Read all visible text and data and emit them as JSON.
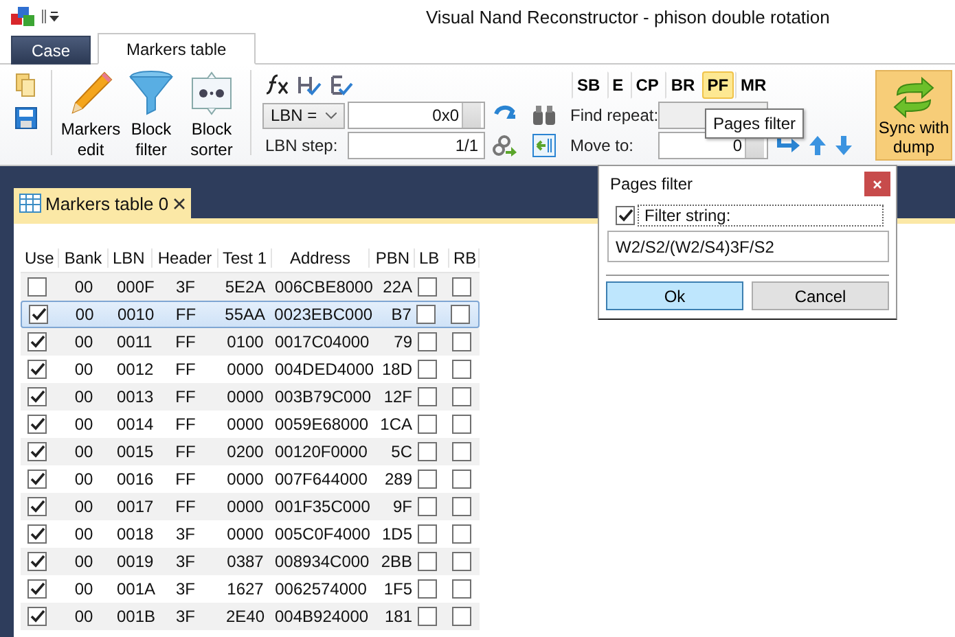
{
  "window": {
    "title": "Visual Nand Reconstructor - phison double rotation"
  },
  "ribbon_tabs": [
    {
      "label": "Case",
      "selected": false
    },
    {
      "label": "Markers table",
      "selected": true
    }
  ],
  "ribbon": {
    "large_buttons": [
      {
        "label": "Markers edit",
        "kind": "pencil"
      },
      {
        "label": "Block filter",
        "kind": "funnel"
      },
      {
        "label": "Block sorter",
        "kind": "sorter"
      }
    ],
    "lbn_mode": "LBN =",
    "lbn_value": "0x0",
    "lbn_step_label": "LBN step:",
    "lbn_step_value": "1/1",
    "mode_buttons": [
      {
        "label": "SB",
        "selected": false
      },
      {
        "label": "E",
        "selected": false
      },
      {
        "label": "CP",
        "selected": false
      },
      {
        "label": "BR",
        "selected": false
      },
      {
        "label": "PF",
        "selected": true
      },
      {
        "label": "MR",
        "selected": false
      }
    ],
    "find_repeat_label": "Find repeat:",
    "move_to_label": "Move to:",
    "move_to_value": "0",
    "sync_button": "Sync with dump"
  },
  "tooltip": "Pages filter",
  "document_tab": {
    "label": "Markers table 0"
  },
  "table": {
    "columns": [
      "Use",
      "Bank",
      "LBN",
      "Header",
      "Test 1",
      "Address",
      "PBN",
      "LB",
      "RB"
    ],
    "rows": [
      {
        "use": false,
        "selected": false,
        "bank": "00",
        "lbn": "000F",
        "header": "3F",
        "test_1": "5E2A",
        "address": "006CBE8000",
        "pbn": "22A",
        "lb": false,
        "rb": false
      },
      {
        "use": true,
        "selected": true,
        "bank": "00",
        "lbn": "0010",
        "header": "FF",
        "test_1": "55AA",
        "address": "0023EBC000",
        "pbn": "B7",
        "lb": false,
        "rb": false
      },
      {
        "use": true,
        "selected": false,
        "bank": "00",
        "lbn": "0011",
        "header": "FF",
        "test_1": "0100",
        "address": "0017C04000",
        "pbn": "79",
        "lb": false,
        "rb": false
      },
      {
        "use": true,
        "selected": false,
        "bank": "00",
        "lbn": "0012",
        "header": "FF",
        "test_1": "0000",
        "address": "004DED4000",
        "pbn": "18D",
        "lb": false,
        "rb": false
      },
      {
        "use": true,
        "selected": false,
        "bank": "00",
        "lbn": "0013",
        "header": "FF",
        "test_1": "0000",
        "address": "003B79C000",
        "pbn": "12F",
        "lb": false,
        "rb": false
      },
      {
        "use": true,
        "selected": false,
        "bank": "00",
        "lbn": "0014",
        "header": "FF",
        "test_1": "0000",
        "address": "0059E68000",
        "pbn": "1CA",
        "lb": false,
        "rb": false
      },
      {
        "use": true,
        "selected": false,
        "bank": "00",
        "lbn": "0015",
        "header": "FF",
        "test_1": "0200",
        "address": "00120F0000",
        "pbn": "5C",
        "lb": false,
        "rb": false
      },
      {
        "use": true,
        "selected": false,
        "bank": "00",
        "lbn": "0016",
        "header": "FF",
        "test_1": "0000",
        "address": "007F644000",
        "pbn": "289",
        "lb": false,
        "rb": false
      },
      {
        "use": true,
        "selected": false,
        "bank": "00",
        "lbn": "0017",
        "header": "FF",
        "test_1": "0000",
        "address": "001F35C000",
        "pbn": "9F",
        "lb": false,
        "rb": false
      },
      {
        "use": true,
        "selected": false,
        "bank": "00",
        "lbn": "0018",
        "header": "3F",
        "test_1": "0000",
        "address": "005C0F4000",
        "pbn": "1D5",
        "lb": false,
        "rb": false
      },
      {
        "use": true,
        "selected": false,
        "bank": "00",
        "lbn": "0019",
        "header": "3F",
        "test_1": "0387",
        "address": "008934C000",
        "pbn": "2BB",
        "lb": false,
        "rb": false
      },
      {
        "use": true,
        "selected": false,
        "bank": "00",
        "lbn": "001A",
        "header": "3F",
        "test_1": "1627",
        "address": "0062574000",
        "pbn": "1F5",
        "lb": false,
        "rb": false
      },
      {
        "use": true,
        "selected": false,
        "bank": "00",
        "lbn": "001B",
        "header": "3F",
        "test_1": "2E40",
        "address": "004B924000",
        "pbn": "181",
        "lb": false,
        "rb": false
      }
    ]
  },
  "dialog": {
    "title": "Pages filter",
    "filter_enabled": true,
    "filter_label": "Filter string:",
    "filter_value": "W2/S2/(W2/S4)3F/S2",
    "buttons": [
      {
        "label": "Ok",
        "default": true
      },
      {
        "label": "Cancel",
        "default": false
      }
    ]
  }
}
